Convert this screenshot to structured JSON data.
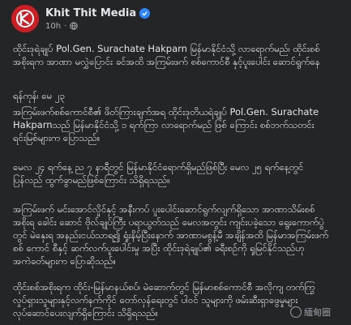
{
  "header": {
    "page_name": "Khit Thit Media",
    "time": "10h",
    "separator": "·",
    "verified_icon": "verified-badge-icon",
    "privacy_icon": "globe-icon"
  },
  "post": {
    "paragraphs": [
      "ထိုင်းဒုရဲချုပ် Pol.Gen. Surachate Hakparn မြန်မာနိုင်ငံသို့ လာရောက်မည်၊ ထိုင်းစစ်အစိုးရက အာဏာ မလွှဲပြောင်း ခင်အထိ အကြမ်းဖက် စစ်ကောင်စီ နှင့်ပူးပေါင်း ဆောင်ရွက်နေ",
      "ရန်ကုန်၊ မေ ၂၃",
      "အကြမ်းဖက်စစ်ကောင်စီ၏ ဖိတ်ကြားချက်အရ ထိုင်းဒုတိယရဲချုပ် Pol.Gen. Surachate Hakparnသည် မြန်မာနိုင်ငံသို့ ၁ ရက်ကြာ လာရောက်မည် ဖြစ် ကြောင်း စစ်ဘက်သတင်းရင်းမြစ်များက ပြောသည်။",
      "မေလ ၂၄ ရက်နေ့ ည ၇ နာရီတွင် မြန်မာနိုင်ငံရောက်ရှိမည်ဖြစ်ပြီး မေလ ၂၅ ရက်နေ့တွင် ပြန်လည် ထွက်ခွာမည်ဖြစ်ကြောင်း သိရှိရသည်။",
      "အကြမ်းဖက် မင်းအောင်လှိုင်နှင့် အနီးကပ် ပူးပေါင်းဆောင်ရွက်လျက်ရှိသော အာဏာသိမ်းစစ်အစိုးရ ခေါင်း ဆောင် ဗိုလ်ချုပ်ကြီး ပရာယွတ်သည် မေလအတွင်း ကျင်းပခဲ့သော ရွေးကောက်ပွဲတွင် မဲနှေးရ အနည်းငယ်သာရ၍ ရှုံးနိမ့်ပြီးနောက် အာဏာမစွန့်မီ အချိန်အထိ မြန်မာအကြမ်းဖက်စစ် ကောင် စီနှင့် ဆက်လက်ပူးပေါင်းမှု အပြီး ထိုင်းဒုရဲချုပ်၏ ခရီးစဉ်ကို ရှုမြင်နိုင်သည်ဟု အကဲခတ်များက ပြောဆိုသည်။",
      "ထိုင်းစစ်အစိုးရက ထိုင်း-မြန်မာနယ်စပ်၊ မဲဆောက်တွင် မြန်မာစစ်ကောင်စီ အလိုကျ တက်ကြွလှုပ်ရှားသူများနှင့်လက်နက်ကိုင် တော်လှန်ရေးတွင် ပါဝင် သူများကို ဖမ်းဆီးရှာဖွေမှုများ လုပ်ဆောင်ပေးလျက်ရှိကြောင်း သိရှိရသည်။"
    ]
  },
  "watermark": {
    "text": "緬甸圈"
  }
}
